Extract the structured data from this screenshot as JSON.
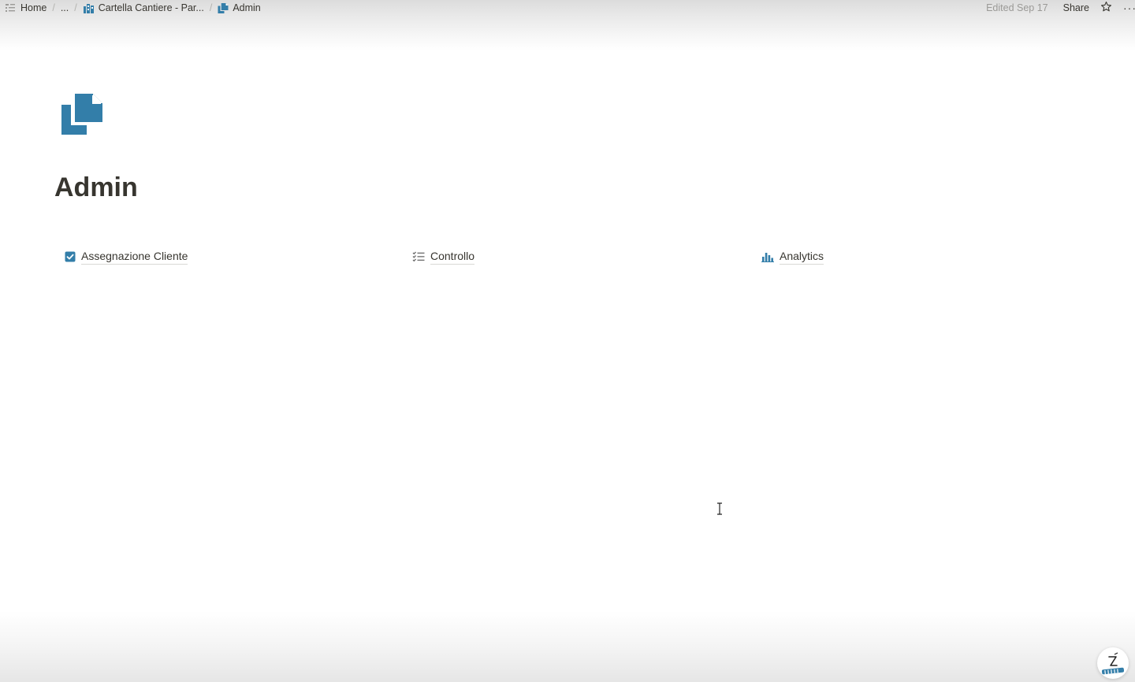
{
  "topbar": {
    "breadcrumb": [
      {
        "label": "Home",
        "icon": "home-icon"
      },
      {
        "label": "..."
      },
      {
        "label": "Cartella Cantiere - Par...",
        "icon": "building-icon"
      },
      {
        "label": "Admin",
        "icon": "documents-icon"
      }
    ],
    "separator": "/",
    "edited": "Edited Sep 17",
    "share_label": "Share",
    "more_label": "···"
  },
  "page": {
    "icon": "documents-icon",
    "title": "Admin",
    "accent_color": "#337ea9"
  },
  "links": [
    {
      "label": "Assegnazione Cliente",
      "icon": "checkbox-icon"
    },
    {
      "label": "Controllo",
      "icon": "checklist-icon"
    },
    {
      "label": "Analytics",
      "icon": "bar-chart-icon"
    }
  ]
}
